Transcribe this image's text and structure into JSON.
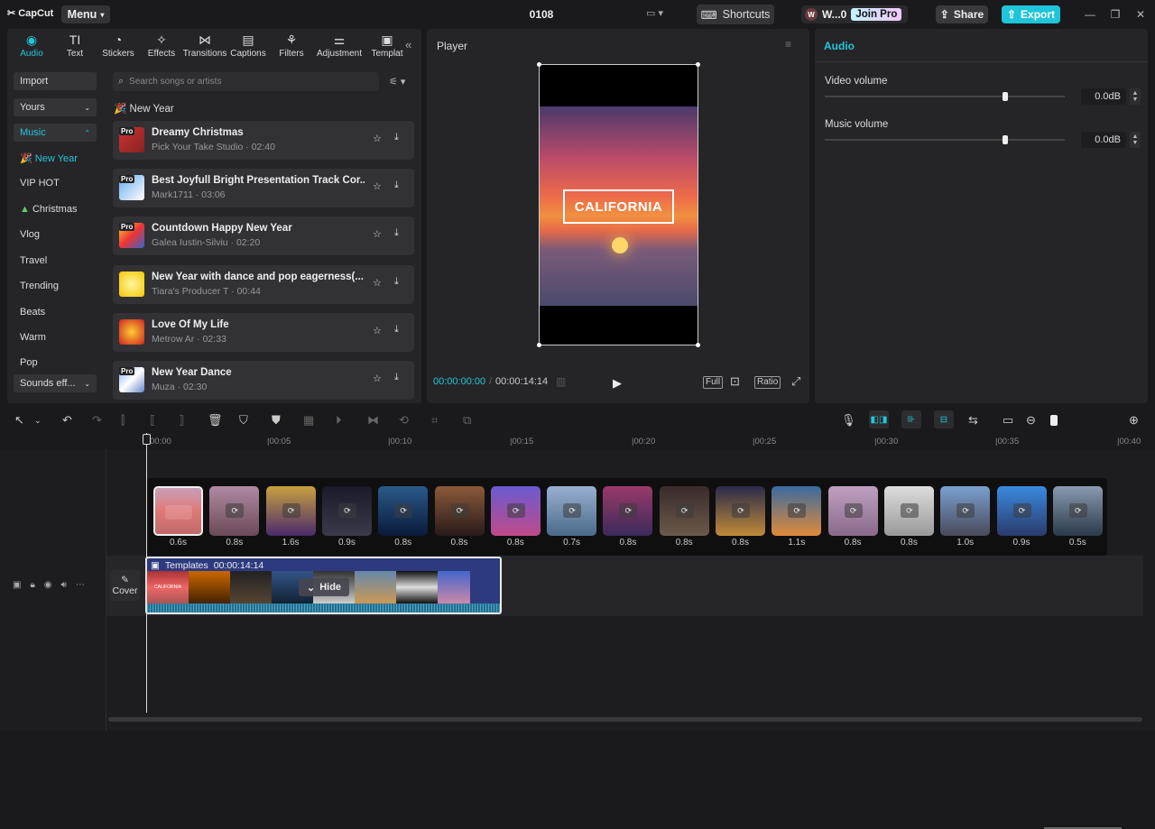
{
  "app": {
    "logo": "CapCut",
    "menu_label": "Menu",
    "project_title": "0108",
    "shortcuts_label": "Shortcuts",
    "user_initial": "W",
    "user_name": "W...0",
    "join_pro": "Join Pro",
    "share_label": "Share",
    "export_label": "Export"
  },
  "tabs": [
    {
      "label": "Audio",
      "icon": "audio-icon"
    },
    {
      "label": "Text",
      "icon": "text-icon"
    },
    {
      "label": "Stickers",
      "icon": "sticker-icon"
    },
    {
      "label": "Effects",
      "icon": "effects-icon"
    },
    {
      "label": "Transitions",
      "icon": "transitions-icon"
    },
    {
      "label": "Captions",
      "icon": "captions-icon"
    },
    {
      "label": "Filters",
      "icon": "filters-icon"
    },
    {
      "label": "Adjustment",
      "icon": "adjustment-icon"
    },
    {
      "label": "Templat",
      "icon": "template-icon"
    }
  ],
  "sidebar": {
    "import": "Import",
    "yours": "Yours",
    "music": "Music",
    "items": [
      "New Year",
      "VIP HOT",
      "Christmas",
      "Vlog",
      "Travel",
      "Trending",
      "Beats",
      "Warm",
      "Pop"
    ],
    "sounds": "Sounds eff..."
  },
  "search": {
    "placeholder": "Search songs or artists"
  },
  "category_heading": "New Year",
  "songs": [
    {
      "title": "Dreamy Christmas",
      "sub": "Pick Your Take Studio · 02:40"
    },
    {
      "title": "Best Joyfull Bright Presentation Track Cor...",
      "sub": "Mark1711 · 03:06"
    },
    {
      "title": "Countdown Happy New Year",
      "sub": "Galea Iustin-Silviu · 02:20"
    },
    {
      "title": "New Year with dance and  pop eagerness(...",
      "sub": "Tiara's Producer T · 00:44"
    },
    {
      "title": "Love Of My Life",
      "sub": "Metrow Ar · 02:33"
    },
    {
      "title": "New Year Dance",
      "sub": "Muza · 02:30"
    }
  ],
  "pro_badge": "Pro",
  "player": {
    "title": "Player",
    "overlay_text": "CALIFORNIA",
    "current_time": "00:00:00:00",
    "total_time": "00:00:14:14",
    "full": "Full",
    "ratio": "Ratio"
  },
  "audio_panel": {
    "title": "Audio",
    "video_volume_label": "Video volume",
    "video_volume_value": "0.0dB",
    "music_volume_label": "Music volume",
    "music_volume_value": "0.0dB",
    "video_volume_level": 0.75,
    "music_volume_level": 0.75
  },
  "ruler": [
    "00:00",
    "|00:05",
    "|00:10",
    "|00:15",
    "|00:20",
    "|00:25",
    "|00:30",
    "|00:35",
    "|00:40"
  ],
  "scenes": [
    "0.6s",
    "0.8s",
    "1.6s",
    "0.9s",
    "0.8s",
    "0.8s",
    "0.8s",
    "0.7s",
    "0.8s",
    "0.8s",
    "0.8s",
    "1.1s",
    "0.8s",
    "0.8s",
    "1.0s",
    "0.9s",
    "0.5s"
  ],
  "clip": {
    "label": "Templates",
    "duration": "00:00:14:14",
    "hide": "Hide",
    "mini_text": "CALIFORNIA"
  },
  "cover_label": "Cover",
  "accent": "#23c6d9"
}
